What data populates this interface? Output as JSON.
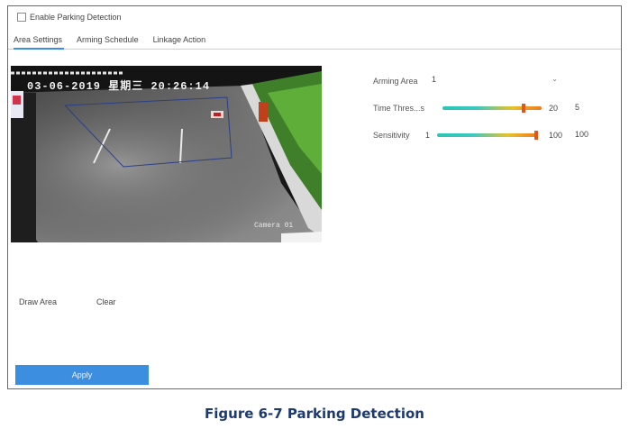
{
  "enable": {
    "label": "Enable Parking Detection",
    "checked": false
  },
  "tabs": [
    {
      "label": "Area Settings",
      "active": true
    },
    {
      "label": "Arming Schedule",
      "active": false
    },
    {
      "label": "Linkage Action",
      "active": false
    }
  ],
  "video": {
    "osd_date": "03-06-2019 星期三 20:26:14",
    "osd_camera": "Camera 01"
  },
  "settings": {
    "arming_area": {
      "label": "Arming Area",
      "value": "1"
    },
    "time_threshold": {
      "label": "Time Thres...",
      "unit": "s",
      "min": "",
      "value_text": "20",
      "value_box": "5",
      "fraction": 0.82
    },
    "sensitivity": {
      "label": "Sensitivity",
      "min": "1",
      "value_text": "100",
      "value_box": "100",
      "fraction": 1.0
    }
  },
  "actions": {
    "draw_area": "Draw Area",
    "clear": "Clear",
    "apply": "Apply"
  },
  "caption": "Figure 6-7 Parking Detection"
}
